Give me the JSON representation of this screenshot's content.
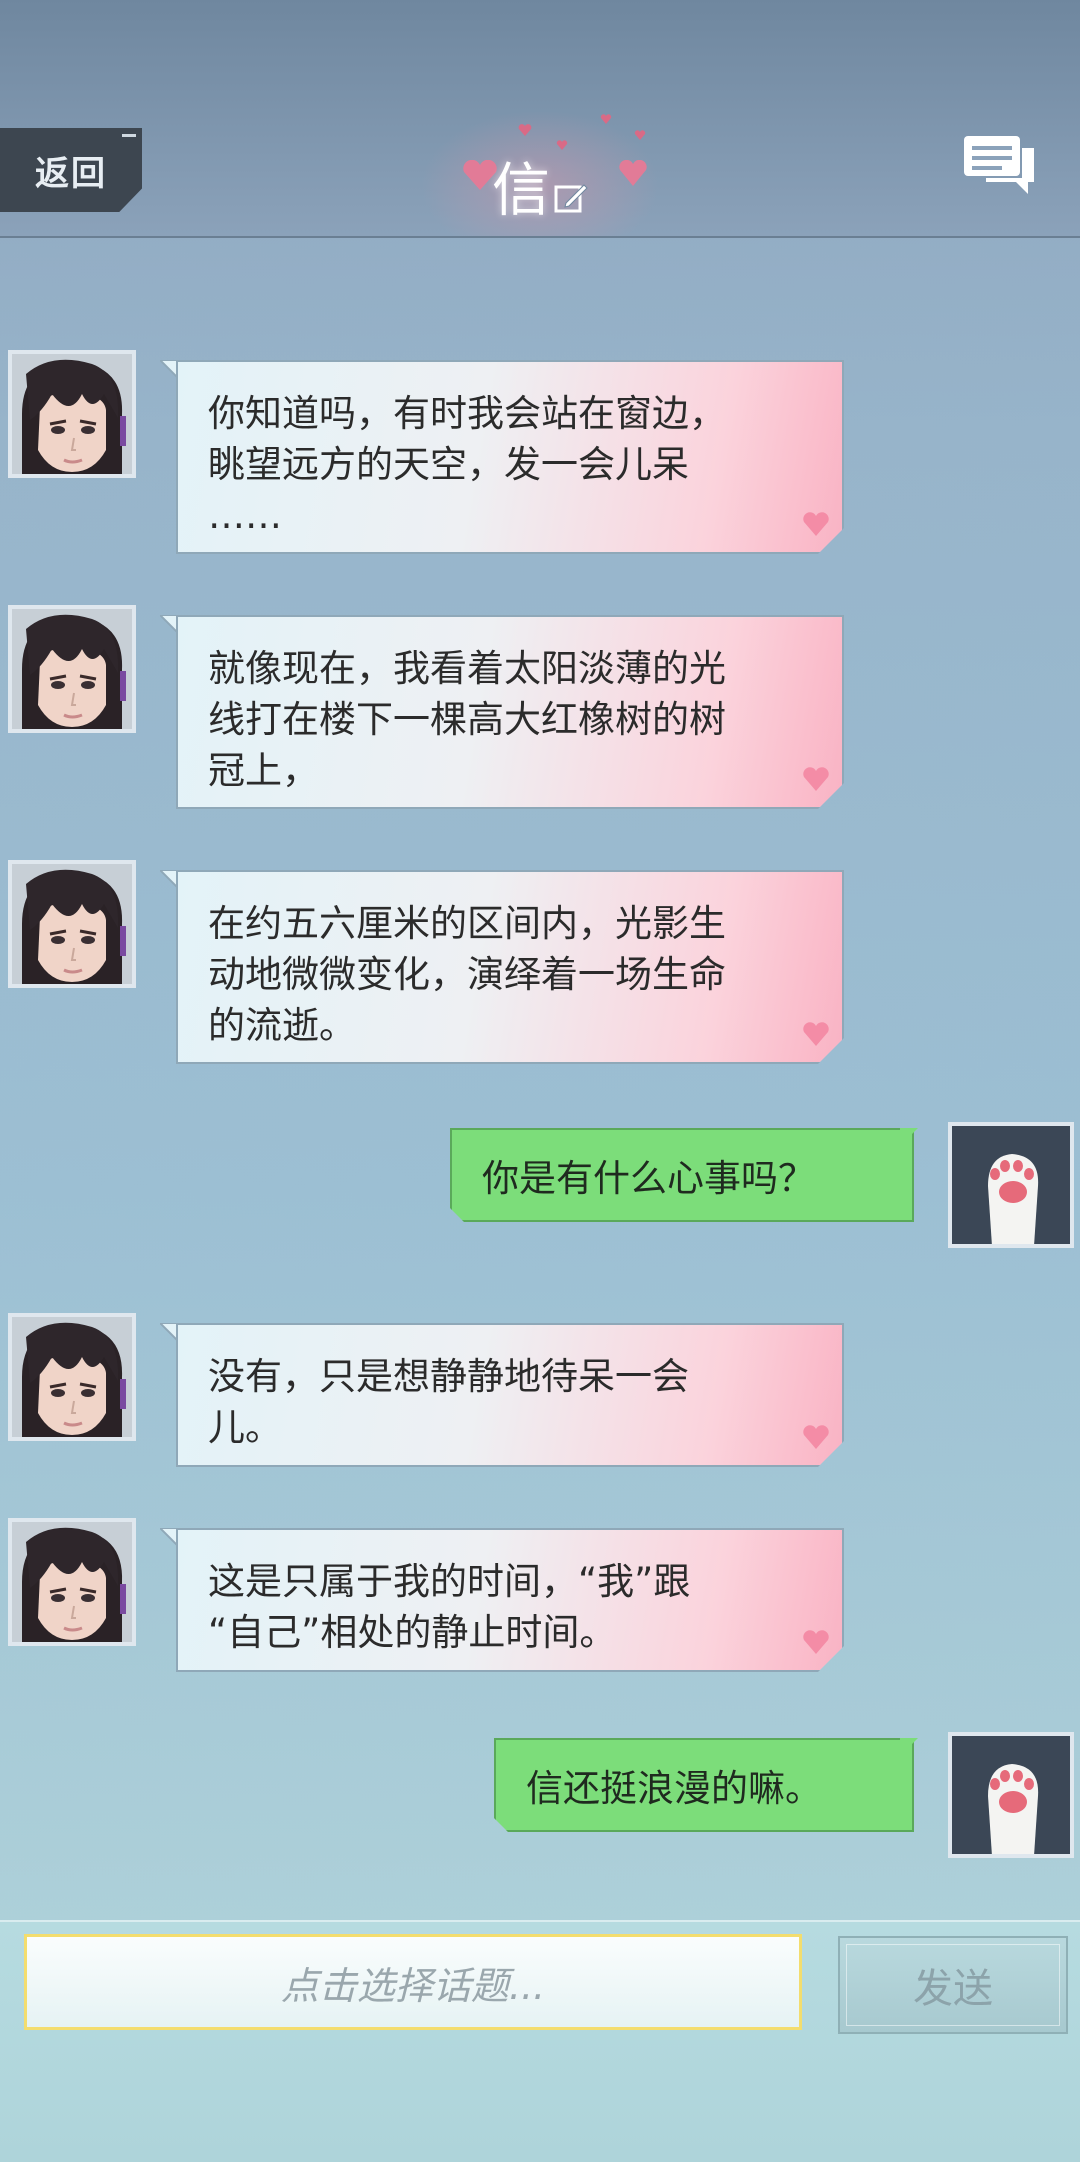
{
  "header": {
    "back_label": "返回",
    "title": "信"
  },
  "messages": [
    {
      "from": "contact",
      "text": "你知道吗，有时我会站在窗边，\n眺望远方的天空，发一会儿呆\n……"
    },
    {
      "from": "contact",
      "text": "就像现在，我看着太阳淡薄的光\n线打在楼下一棵高大红橡树的树\n冠上，"
    },
    {
      "from": "contact",
      "text": "在约五六厘米的区间内，光影生\n动地微微变化，演绎着一场生命\n的流逝。"
    },
    {
      "from": "me",
      "text": "你是有什么心事吗？"
    },
    {
      "from": "contact",
      "text": "没有，只是想静静地待呆一会\n儿。"
    },
    {
      "from": "contact",
      "text": "这是只属于我的时间，“我”跟\n“自己”相处的静止时间。"
    },
    {
      "from": "me",
      "text": "信还挺浪漫的嘛。"
    }
  ],
  "input": {
    "placeholder": "点击选择话题..."
  },
  "send_label": "发送",
  "colors": {
    "incoming_bubble_start": "#e3f3f8",
    "incoming_bubble_end": "#f9b3c4",
    "outgoing_bubble": "#7cdd7a",
    "input_border": "#f3dd6e"
  },
  "icons": {
    "back": "back-button",
    "edit": "pencil-edit-icon",
    "messages": "chat-bubbles-icon",
    "heart": "heart-icon",
    "avatar_contact": "man-portrait",
    "avatar_me": "cat-paw"
  }
}
